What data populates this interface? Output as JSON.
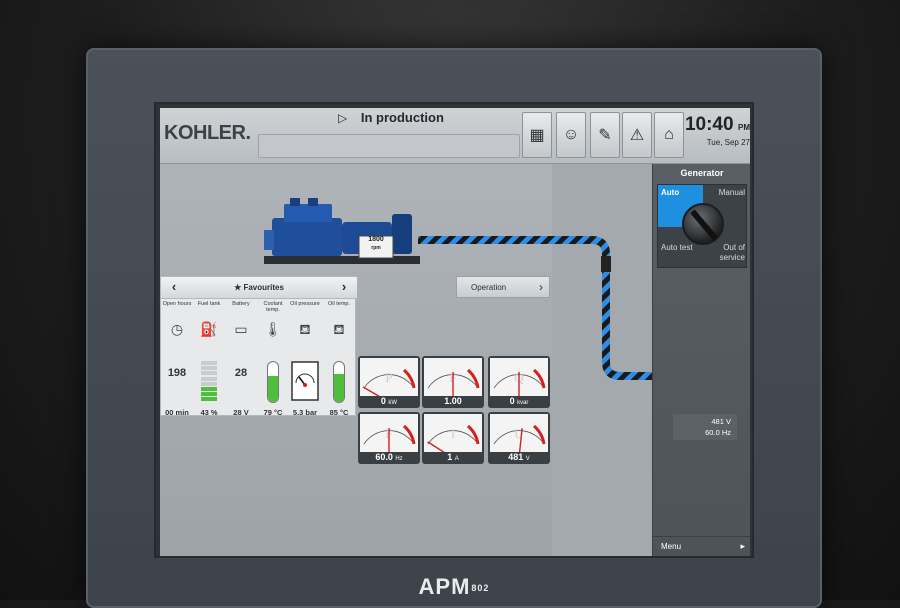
{
  "device": {
    "brand": "APM",
    "model": "802"
  },
  "header": {
    "logo": "KOHLER.",
    "status_icon": "▷",
    "status_text": "In production",
    "buttons": [
      {
        "icon": "grid-icon",
        "glyph": "▦"
      },
      {
        "icon": "operator-icon",
        "glyph": "☺"
      },
      {
        "icon": "tools-icon",
        "glyph": "✎"
      },
      {
        "icon": "warning-icon",
        "glyph": "⚠"
      },
      {
        "icon": "home-icon",
        "glyph": "⌂"
      }
    ],
    "time": "10:40",
    "ampm": "PM",
    "date": "Tue, Sep 27"
  },
  "genset": {
    "rpm_value": "1800",
    "rpm_unit": "rpm"
  },
  "favourites": {
    "title": "Favourites",
    "prev_icon": "‹",
    "next_icon": "›",
    "columns": [
      {
        "label": "Open hours",
        "icon": "clock-icon",
        "glyph": "◷",
        "big": "198",
        "value": "00 min"
      },
      {
        "label": "Fuel tank",
        "icon": "fuel-icon",
        "glyph": "⛽",
        "value": "43 %",
        "level": 0.43
      },
      {
        "label": "Battery",
        "icon": "battery-icon",
        "glyph": "▭",
        "big": "28",
        "value": "28 V"
      },
      {
        "label": "Coolant temp.",
        "icon": "coolant-icon",
        "glyph": "🌡",
        "value": "79 °C",
        "level": 0.65
      },
      {
        "label": "Oil pressure",
        "icon": "oil-can-icon",
        "glyph": "⛾",
        "value": "5.3 bar"
      },
      {
        "label": "Oil temp.",
        "icon": "oil-temp-icon",
        "glyph": "⛾",
        "value": "85 °C",
        "level": 0.7
      }
    ]
  },
  "operation": {
    "label": "Operation",
    "arrow": "›"
  },
  "meters": [
    {
      "letter": "P",
      "value": "0",
      "unit": "kW",
      "needle": 0.0
    },
    {
      "letter": "F",
      "value": "1.00",
      "unit": "",
      "needle": 0.5
    },
    {
      "letter": "Q",
      "value": "0",
      "unit": "kvar",
      "needle": 0.5
    },
    {
      "letter": "F",
      "value": "60.0",
      "unit": "Hz",
      "needle": 0.5
    },
    {
      "letter": "I",
      "value": "1",
      "unit": "A",
      "needle": 0.02
    },
    {
      "letter": "U",
      "value": "481",
      "unit": "V",
      "needle": 0.55
    }
  ],
  "right_panel": {
    "title": "Generator",
    "modes": {
      "auto": "Auto",
      "manual": "Manual",
      "auto_test": "Auto test",
      "out_of_service": "Out of service"
    },
    "voltage": "481 V",
    "frequency": "60.0 Hz",
    "menu_label": "Menu",
    "menu_arrow": "▸"
  },
  "colors": {
    "accent_blue": "#1f8fe0",
    "gauge_red": "#d42020",
    "bar_green": "#4fbf3b",
    "cable_blue": "#2f8de8"
  }
}
